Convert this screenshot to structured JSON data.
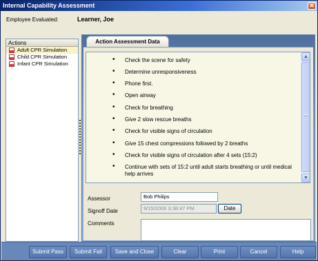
{
  "window": {
    "title": "Internal Capability Assessment"
  },
  "header": {
    "employee_label": "Employee Evaluated:",
    "employee_name": "Learner, Joe"
  },
  "actions": {
    "header": "Actions",
    "items": [
      {
        "label": "Adult CPR Simulation",
        "selected": true
      },
      {
        "label": "Child CPR Simulation",
        "selected": false
      },
      {
        "label": "Infant CPR Simulation",
        "selected": false
      }
    ]
  },
  "tab": {
    "label": "Action Assessment Data"
  },
  "steps": [
    "Check the scene for safety",
    "Determine unresponsiveness",
    "Phone first.",
    "Open airway",
    "Check for breathing",
    "Give 2 slow rescue breaths",
    "Check for visible signs of circulation",
    "Give 15 chest compressions followed by 2 breaths",
    "Check for visible signs of circulation after 4 sets (15:2)",
    "Continue with sets of 15:2 until adult starts breathing or until medical help arrives"
  ],
  "form": {
    "assessor_label": "Assessor",
    "assessor_value": "Bob Philips",
    "signoff_label": "Signoff Date",
    "signoff_value": "9/15/2006 3:38:47 PM",
    "date_button": "Date",
    "comments_label": "Comments",
    "comments_value": ""
  },
  "footer": {
    "submit_pass": "Submit Pass",
    "submit_fail": "Submit Fail",
    "save_close": "Save and Close",
    "clear": "Clear",
    "print": "Print",
    "cancel": "Cancel",
    "help": "Help"
  },
  "colors": {
    "title_bar": "#0a246a",
    "footer": "#6688bb",
    "tab_panel": "#7a98c8",
    "selected_item": "#f7f3c7"
  },
  "icons": {
    "close": "close-icon",
    "action_item": "document-icon",
    "scroll_up": "chevron-up-icon",
    "scroll_down": "chevron-down-icon"
  }
}
